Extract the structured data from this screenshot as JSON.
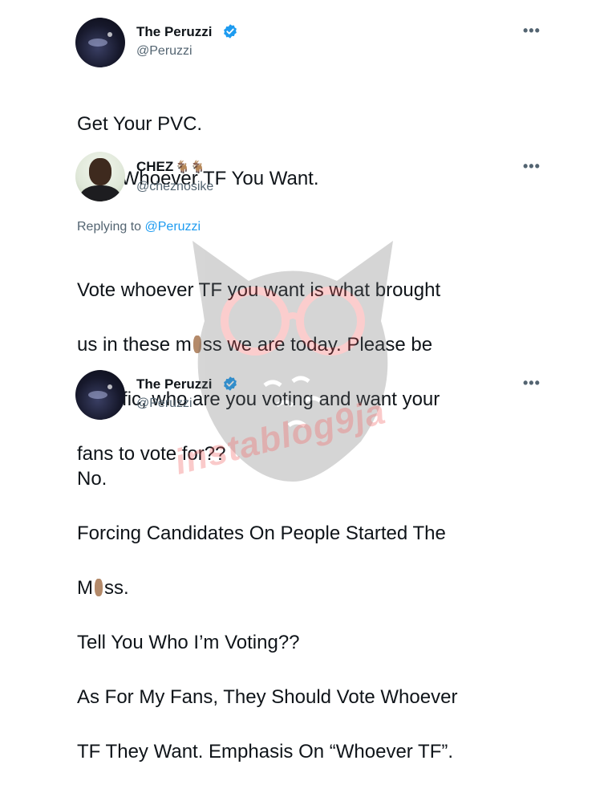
{
  "tweets": [
    {
      "name": "The Peruzzi",
      "handle": "@Peruzzi",
      "verified": true,
      "body_lines": [
        "Get Your PVC.",
        "Vote Whoever TF You Want."
      ]
    },
    {
      "name": "CHEZ",
      "name_emoji": "🐐🐐",
      "handle": "@cheznosike",
      "replying_prefix": "Replying to",
      "replying_to": "@Peruzzi",
      "line1": "Vote whoever TF you want is what brought",
      "line2_a": "us in these m",
      "line2_b": "ss we are today. Please be",
      "line3": "specific, who are you voting and want your",
      "line4": "fans to vote for??"
    },
    {
      "name": "The Peruzzi",
      "handle": "@Peruzzi",
      "verified": true,
      "line1": "No.",
      "line2": "Forcing Candidates On People Started The",
      "line3_a": "M",
      "line3_b": "ss.",
      "line4": "Tell You Who I’m Voting??",
      "line5": "As For My Fans, They Should Vote Whoever",
      "line6": "TF They Want. Emphasis On “Whoever TF”."
    }
  ],
  "more_label": "•••",
  "watermark_text": "instablog9ja",
  "colors": {
    "verified": "#1d9bf0",
    "link": "#1d9bf0",
    "secondary": "#536471"
  }
}
